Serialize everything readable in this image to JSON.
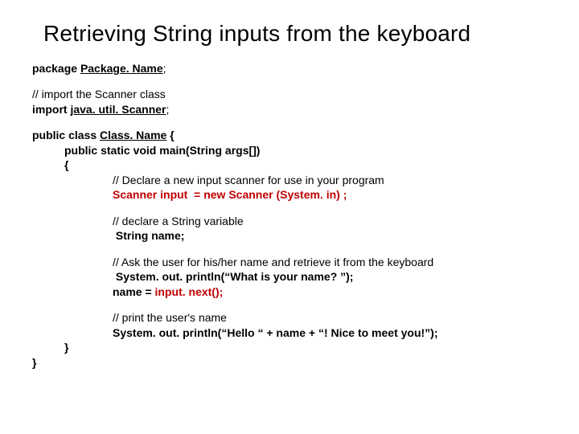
{
  "title": "Retrieving String inputs from the keyboard",
  "l1a": "package ",
  "l1b": "Package. Name",
  "l1c": ";",
  "l2": "// import the Scanner class",
  "l3a": "import ",
  "l3b": "java. util. Scanner",
  "l3c": ";",
  "l4a": "public class ",
  "l4b": "Class. Name",
  "l4c": " {",
  "l5": "public static void main(String args[])",
  "l6": "{",
  "l7": "// Declare a new input scanner for use in your program",
  "l8a": "Scanner ",
  "l8b": "input",
  "l8c": "  = new Scanner (System. in) ; ",
  "l9": "// declare a String variable",
  "l10": " String name;",
  "l11": "// Ask the user for his/her name and retrieve it from the keyboard",
  "l12": " System. out. println(“What is your name? ”);",
  "l13a": "name = ",
  "l13b": "input. next();",
  "l14": "// print the user's name",
  "l15": "System. out. println(“Hello “ + name + “! Nice to meet you!”);",
  "l16": "}",
  "l17": "}"
}
